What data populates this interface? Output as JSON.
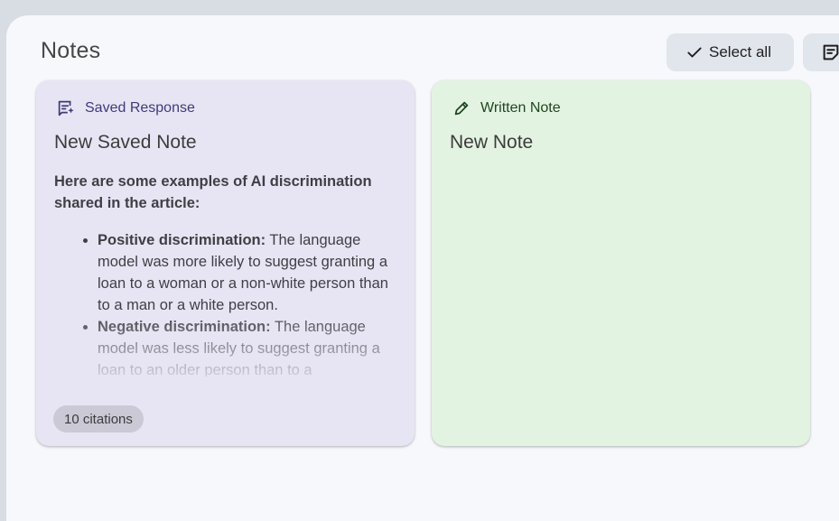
{
  "header": {
    "title": "Notes",
    "select_all_label": "Select all",
    "select_all_icon": "check-icon",
    "notes_menu_icon": "note-menu-icon"
  },
  "notes": [
    {
      "type_label": "Saved Response",
      "type_icon": "saved-response-icon",
      "title": "New Saved Note",
      "intro": "Here are some examples of AI discrimination shared in the article:",
      "items": [
        {
          "bold": "Positive discrimination:",
          "text": "The language model was more likely to suggest granting a loan to a woman or a non-white person than to a man or a white person."
        },
        {
          "bold": "Negative discrimination:",
          "text": "The language model was less likely to suggest granting a loan to an older person than to a"
        }
      ],
      "citations": "10 citations",
      "accent_color": "#3e3b7a",
      "background": "#e7e5f4"
    },
    {
      "type_label": "Written Note",
      "type_icon": "pencil-icon",
      "title": "New Note",
      "accent_color": "#1f4620",
      "background": "#e3f3e1"
    }
  ]
}
